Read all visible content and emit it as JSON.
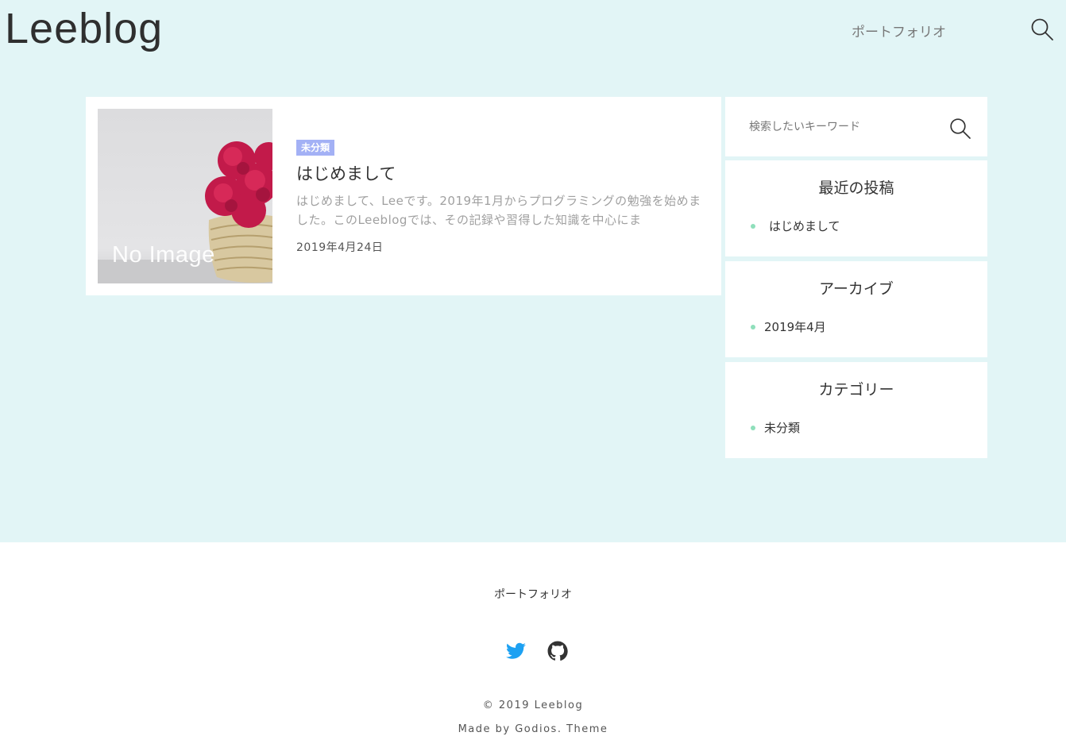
{
  "site": {
    "title": "Leeblog",
    "brand_bg": "#e2f5f6"
  },
  "header": {
    "nav_label": "ポートフォリオ",
    "search_icon": "search-icon"
  },
  "post": {
    "thumbnail_label": "No Image",
    "category": "未分類",
    "title": "はじめまして",
    "excerpt": "はじめまして、Leeです。2019年1月からプログラミングの勉強を始めました。このLeeblogでは、その記録や習得した知識を中心にま",
    "date": "2019年4月24日"
  },
  "sidebar": {
    "search_placeholder": "検索したいキーワード",
    "recent": {
      "title": "最近の投稿",
      "items": [
        "はじめまして"
      ]
    },
    "archive": {
      "title": "アーカイブ",
      "items": [
        "2019年4月"
      ]
    },
    "categories": {
      "title": "カテゴリー",
      "items": [
        "未分類"
      ]
    }
  },
  "footer": {
    "nav_label": "ポートフォリオ",
    "social": [
      "twitter-icon",
      "github-icon"
    ],
    "copyright": "© 2019 Leeblog",
    "made_by": "Made by Godios. Theme"
  },
  "colors": {
    "accent_badge": "#a3b1f5",
    "bullet": "#8fdfbb",
    "twitter": "#1da1f2"
  }
}
